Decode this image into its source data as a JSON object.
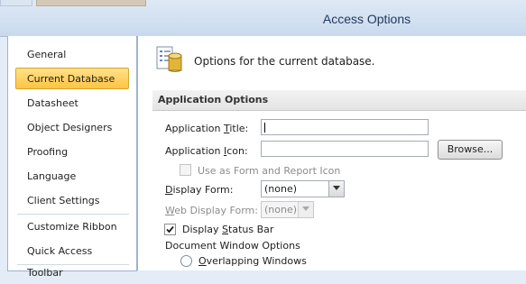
{
  "window": {
    "title": "Access Options"
  },
  "nav": {
    "items": [
      {
        "label": "General"
      },
      {
        "label": "Current Database"
      },
      {
        "label": "Datasheet"
      },
      {
        "label": "Object Designers"
      },
      {
        "label": "Proofing"
      },
      {
        "label": "Language"
      },
      {
        "label": "Client Settings"
      },
      {
        "label": "Customize Ribbon"
      },
      {
        "label": "Quick Access Toolbar"
      }
    ],
    "selected": "Current Database"
  },
  "header": {
    "text": "Options for the current database.",
    "icon": "database-options-icon"
  },
  "application_options": {
    "section_title": "Application Options",
    "app_title": {
      "label_pre": "Application ",
      "label_key": "T",
      "label_post": "itle:",
      "value": ""
    },
    "app_icon": {
      "label_pre": "Application ",
      "label_key": "I",
      "label_post": "con:",
      "value": ""
    },
    "browse_button": "Browse...",
    "use_as_icon": {
      "label": "Use as Form and Report Icon",
      "checked": false,
      "enabled": false
    },
    "display_form": {
      "label_pre": "",
      "label_key": "D",
      "label_post": "isplay Form:",
      "value": "(none)"
    },
    "web_display_form": {
      "label_pre": "",
      "label_key": "W",
      "label_post": "eb Display Form:",
      "value": "(none)",
      "enabled": false
    },
    "display_status_bar": {
      "label_pre": "Display ",
      "label_key": "S",
      "label_post": "tatus Bar",
      "checked": true
    },
    "document_window_options": {
      "label": "Document Window Options"
    },
    "overlapping_windows": {
      "label_pre": "",
      "label_key": "O",
      "label_post": "verlapping Windows",
      "selected": false
    }
  }
}
